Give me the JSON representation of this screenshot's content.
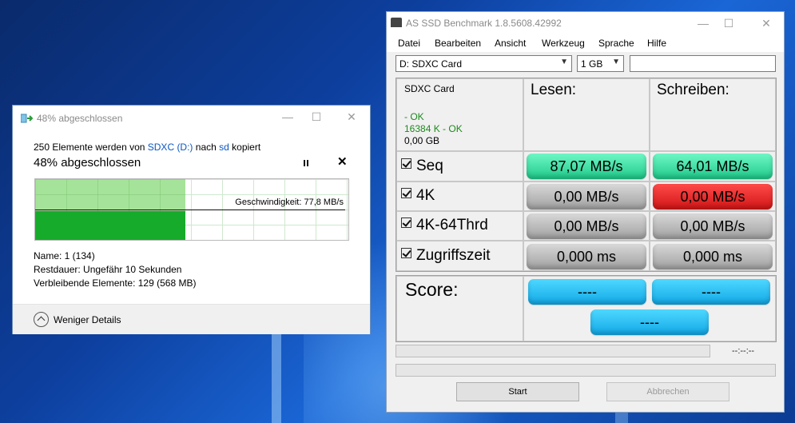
{
  "copy_dialog": {
    "title": "48% abgeschlossen",
    "line1_prefix": "250 Elemente werden von ",
    "source_name": "SDXC (D:)",
    "line1_middle": " nach ",
    "dest_name": "sd",
    "line1_suffix": " kopiert",
    "heading": "48% abgeschlossen",
    "progress_fraction": 0.48,
    "speed_label": "Geschwindigkeit: 77,8 MB/s",
    "name_line": "Name: 1 (134)",
    "remaining_time": "Restdauer: Ungefähr 10 Sekunden",
    "remaining_items": "Verbleibende Elemente: 129 (568 MB)",
    "less_details": "Weniger Details",
    "stop_glyph": "✕",
    "colors": {
      "graph_fill": "#16ab2a",
      "graph_done_bg": "#a6e39a",
      "link": "#0a57c2"
    },
    "icons": [
      "copy-icon",
      "minimize-icon",
      "maximize-icon",
      "close-icon",
      "pause-icon",
      "chevron-up-icon"
    ]
  },
  "ssd": {
    "title": "AS SSD Benchmark 1.8.5608.42992",
    "menu": [
      "Datei",
      "Bearbeiten",
      "Ansicht",
      "Werkzeug",
      "Sprache",
      "Hilfe"
    ],
    "drive_select": "D: SDXC Card",
    "size_select": "1 GB",
    "drive_info": {
      "name": "SDXC Card",
      "status1": " - OK",
      "status2": "16384 K - OK",
      "capacity": "0,00 GB"
    },
    "col_read": "Lesen:",
    "col_write": "Schreiben:",
    "rows": [
      {
        "label": "Seq",
        "read": "87,07 MB/s",
        "write": "64,01 MB/s"
      },
      {
        "label": "4K",
        "read": "0,00 MB/s",
        "write": "0,00 MB/s"
      },
      {
        "label": "4K-64Thrd",
        "read": "0,00 MB/s",
        "write": "0,00 MB/s"
      },
      {
        "label": "Zugriffszeit",
        "read": "0,000 ms",
        "write": "0,000 ms"
      }
    ],
    "score_label": "Score:",
    "score_read": "----",
    "score_write": "----",
    "score_total": "----",
    "time_readout": "--:--:--",
    "start_button": "Start",
    "cancel_button": "Abbrechen",
    "colors": {
      "good": "#1ec98a",
      "idle": "#a0a0a0",
      "bad": "#d11515",
      "score": "#11a8e6",
      "ok_text": "#1d8a1d"
    }
  }
}
